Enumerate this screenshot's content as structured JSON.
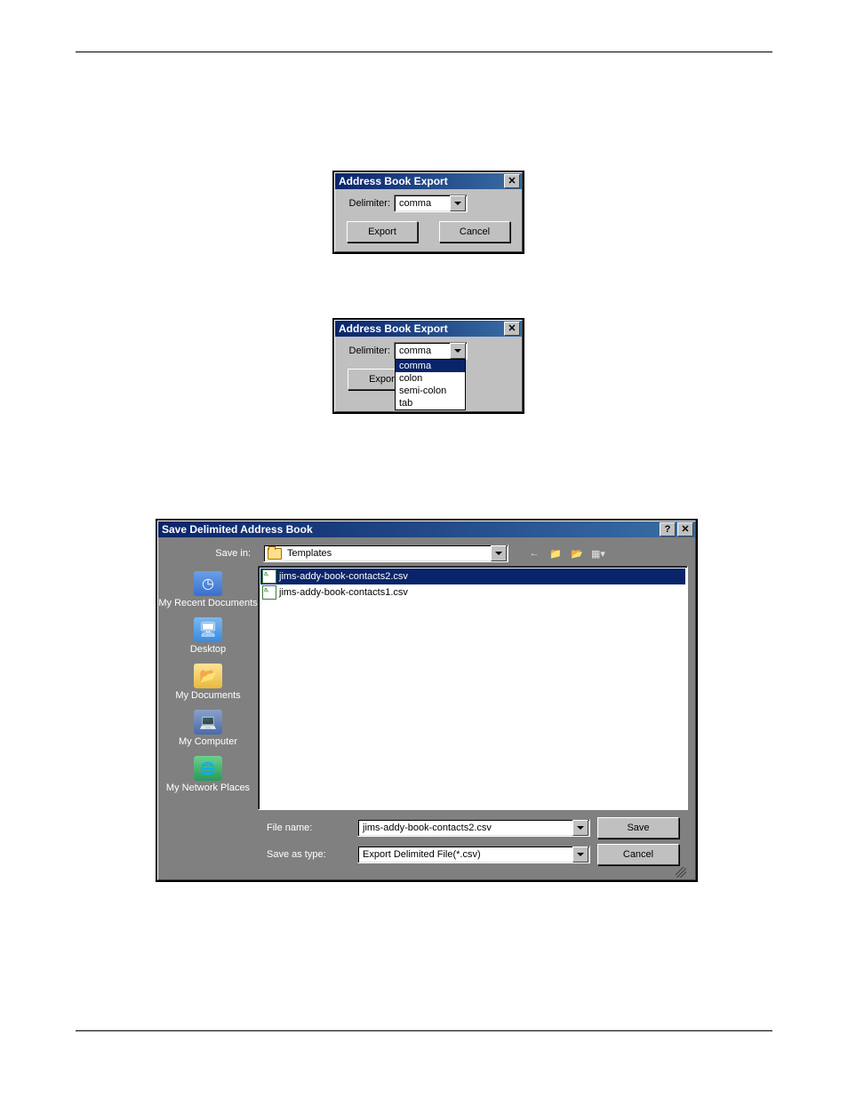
{
  "dialog1": {
    "title": "Address Book Export",
    "delimiter_label": "Delimiter:",
    "delimiter_value": "comma",
    "export_label": "Export",
    "cancel_label": "Cancel"
  },
  "dialog2": {
    "title": "Address Book Export",
    "delimiter_label": "Delimiter:",
    "delimiter_value": "comma",
    "export_label": "Export",
    "options": [
      "comma",
      "colon",
      "semi-colon",
      "tab"
    ],
    "selected_index": 0
  },
  "save_dialog": {
    "title": "Save Delimited Address Book",
    "save_in_label": "Save in:",
    "save_in_value": "Templates",
    "places": [
      {
        "label": "My Recent Documents",
        "icon": "pi-recent"
      },
      {
        "label": "Desktop",
        "icon": "pi-desktop"
      },
      {
        "label": "My Documents",
        "icon": "pi-docs"
      },
      {
        "label": "My Computer",
        "icon": "pi-comp"
      },
      {
        "label": "My Network Places",
        "icon": "pi-net"
      }
    ],
    "files": [
      {
        "name": "jims-addy-book-contacts2.csv",
        "selected": true
      },
      {
        "name": "jims-addy-book-contacts1.csv",
        "selected": false
      }
    ],
    "file_name_label": "File name:",
    "file_name_value": "jims-addy-book-contacts2.csv",
    "save_as_type_label": "Save as type:",
    "save_as_type_value": "Export Delimited File(*.csv)",
    "save_label": "Save",
    "cancel_label": "Cancel"
  }
}
